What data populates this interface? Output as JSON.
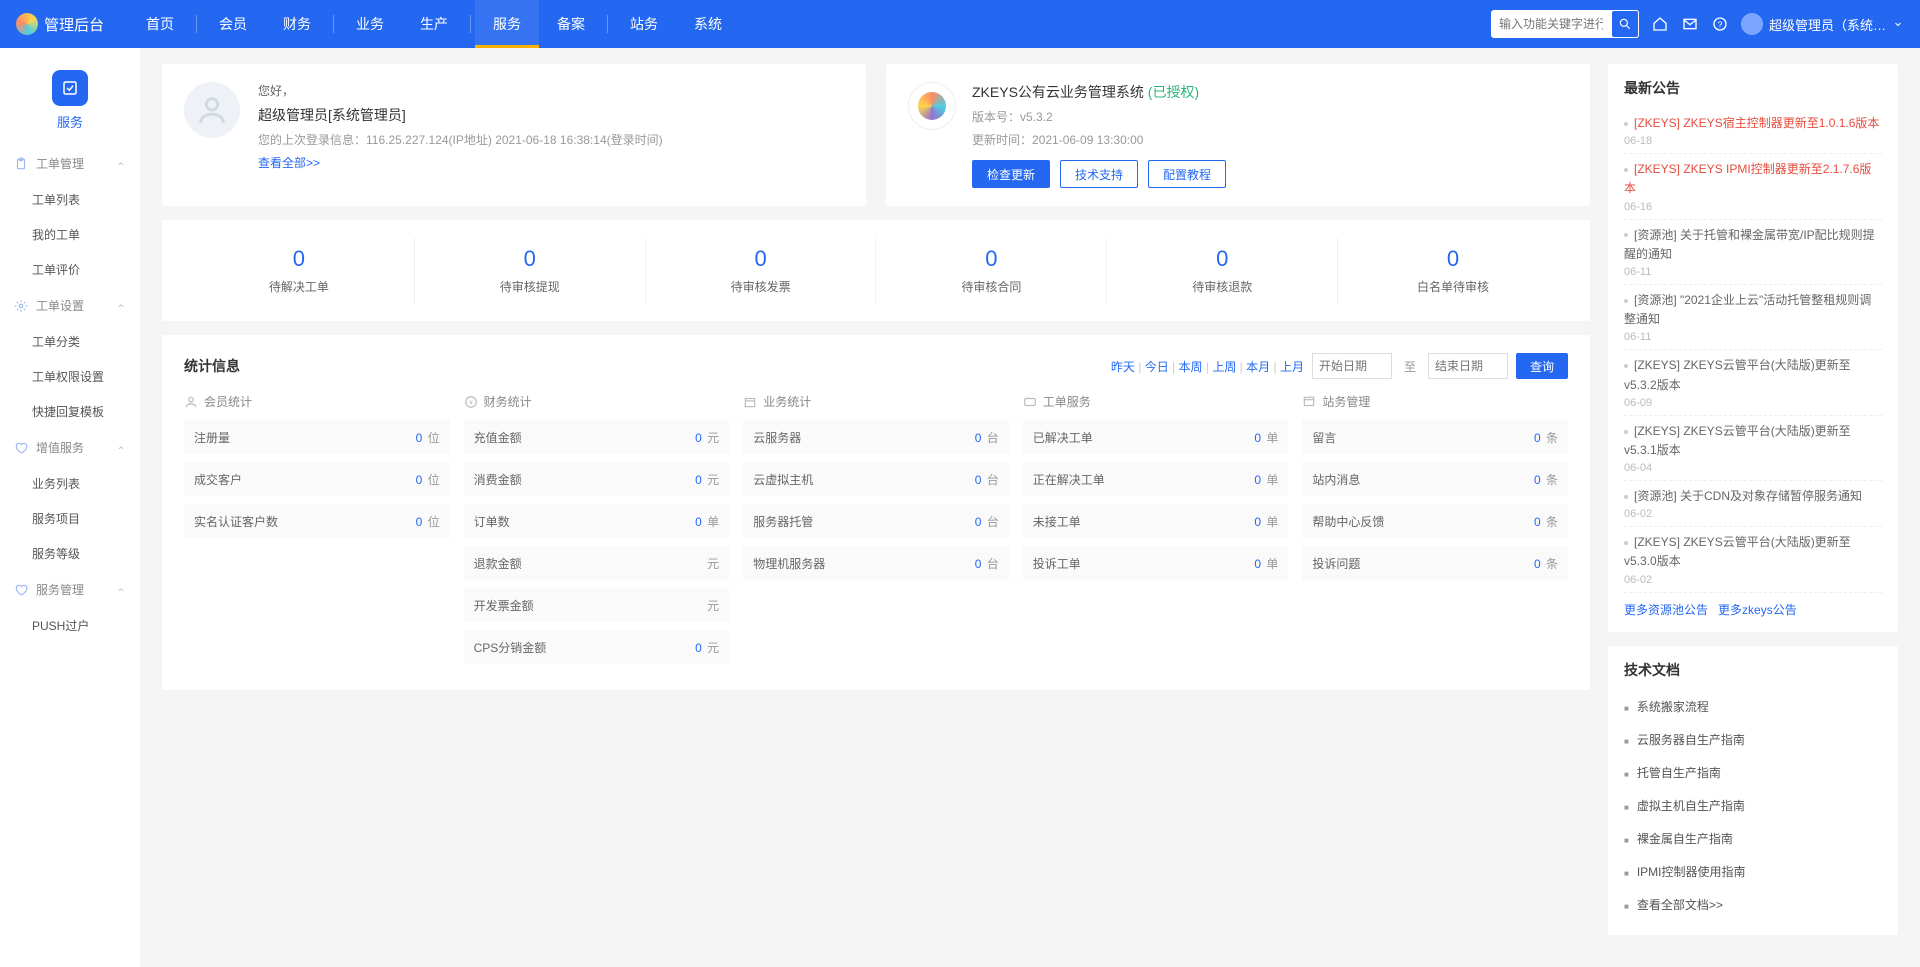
{
  "top": {
    "brand": "管理后台",
    "nav": [
      "首页",
      "会员",
      "财务",
      "业务",
      "生产",
      "服务",
      "备案",
      "站务",
      "系统"
    ],
    "active_index": 5,
    "search_placeholder": "输入功能关键字进行搜索",
    "user_label": "超级管理员（系统…"
  },
  "side": {
    "module_title": "服务",
    "groups": [
      {
        "title": "工单管理",
        "icon": "clipboard",
        "items": [
          "工单列表",
          "我的工单",
          "工单评价"
        ]
      },
      {
        "title": "工单设置",
        "icon": "gear",
        "items": [
          "工单分类",
          "工单权限设置",
          "快捷回复模板"
        ]
      },
      {
        "title": "增值服务",
        "icon": "heart",
        "items": [
          "业务列表",
          "服务项目",
          "服务等级"
        ]
      },
      {
        "title": "服务管理",
        "icon": "heart",
        "items": [
          "PUSH过户"
        ]
      }
    ]
  },
  "welcome": {
    "greet": "您好，",
    "who": "超级管理员[系统管理员]",
    "meta": "您的上次登录信息：116.25.227.124(IP地址) 2021-06-18 16:38:14(登录时间)",
    "view_all": "查看全部>>"
  },
  "sysinfo": {
    "title": "ZKEYS公有云业务管理系统",
    "licensed": "(已授权)",
    "version_label": "版本号：",
    "version": "v5.3.2",
    "update_label": "更新时间：",
    "update_time": "2021-06-09 13:30:00",
    "btn_check": "检查更新",
    "btn_support": "技术支持",
    "btn_guide": "配置教程"
  },
  "strip": [
    {
      "num": "0",
      "label": "待解决工单"
    },
    {
      "num": "0",
      "label": "待审核提现"
    },
    {
      "num": "0",
      "label": "待审核发票"
    },
    {
      "num": "0",
      "label": "待审核合同"
    },
    {
      "num": "0",
      "label": "待审核退款"
    },
    {
      "num": "0",
      "label": "白名单待审核"
    }
  ],
  "stats": {
    "title": "统计信息",
    "ranges": [
      "昨天",
      "今日",
      "本周",
      "上周",
      "本月",
      "上月"
    ],
    "start_ph": "开始日期",
    "to": "至",
    "end_ph": "结束日期",
    "query": "查询",
    "cols": [
      {
        "head": "会员统计",
        "rows": [
          {
            "k": "注册量",
            "v": "0",
            "u": "位"
          },
          {
            "k": "成交客户",
            "v": "0",
            "u": "位"
          },
          {
            "k": "实名认证客户数",
            "v": "0",
            "u": "位"
          }
        ]
      },
      {
        "head": "财务统计",
        "rows": [
          {
            "k": "充值金额",
            "v": "0",
            "u": "元"
          },
          {
            "k": "消费金额",
            "v": "0",
            "u": "元"
          },
          {
            "k": "订单数",
            "v": "0",
            "u": "单"
          },
          {
            "k": "退款金额",
            "v": "",
            "u": "元"
          },
          {
            "k": "开发票金额",
            "v": "",
            "u": "元"
          },
          {
            "k": "CPS分销金额",
            "v": "0",
            "u": "元"
          }
        ]
      },
      {
        "head": "业务统计",
        "rows": [
          {
            "k": "云服务器",
            "v": "0",
            "u": "台"
          },
          {
            "k": "云虚拟主机",
            "v": "0",
            "u": "台"
          },
          {
            "k": "服务器托管",
            "v": "0",
            "u": "台"
          },
          {
            "k": "物理机服务器",
            "v": "0",
            "u": "台"
          }
        ]
      },
      {
        "head": "工单服务",
        "rows": [
          {
            "k": "已解决工单",
            "v": "0",
            "u": "单"
          },
          {
            "k": "正在解决工单",
            "v": "0",
            "u": "单"
          },
          {
            "k": "未接工单",
            "v": "0",
            "u": "单"
          },
          {
            "k": "投诉工单",
            "v": "0",
            "u": "单"
          }
        ]
      },
      {
        "head": "站务管理",
        "rows": [
          {
            "k": "留言",
            "v": "0",
            "u": "条"
          },
          {
            "k": "站内消息",
            "v": "0",
            "u": "条"
          },
          {
            "k": "帮助中心反馈",
            "v": "0",
            "u": "条"
          },
          {
            "k": "投诉问题",
            "v": "0",
            "u": "条"
          }
        ]
      }
    ]
  },
  "notices": {
    "title": "最新公告",
    "list": [
      {
        "t": "[ZKEYS] ZKEYS宿主控制器更新至1.0.1.6版本",
        "d": "06-18",
        "red": true
      },
      {
        "t": "[ZKEYS] ZKEYS IPMI控制器更新至2.1.7.6版本",
        "d": "06-16",
        "red": true
      },
      {
        "t": "[资源池] 关于托管和裸金属带宽/IP配比规则提醒的通知",
        "d": "06-11"
      },
      {
        "t": "[资源池] \"2021企业上云\"活动托管整租规则调整通知",
        "d": "06-11"
      },
      {
        "t": "[ZKEYS] ZKEYS云管平台(大陆版)更新至v5.3.2版本",
        "d": "06-09"
      },
      {
        "t": "[ZKEYS] ZKEYS云管平台(大陆版)更新至v5.3.1版本",
        "d": "06-04"
      },
      {
        "t": "[资源池] 关于CDN及对象存储暂停服务通知",
        "d": "06-02"
      },
      {
        "t": "[ZKEYS] ZKEYS云管平台(大陆版)更新至v5.3.0版本",
        "d": "06-02"
      }
    ],
    "more1": "更多资源池公告",
    "more2": "更多zkeys公告"
  },
  "docs": {
    "title": "技术文档",
    "list": [
      "系统搬家流程",
      "云服务器自生产指南",
      "托管自生产指南",
      "虚拟主机自生产指南",
      "裸金属自生产指南",
      "IPMI控制器使用指南",
      "查看全部文档>>"
    ]
  }
}
